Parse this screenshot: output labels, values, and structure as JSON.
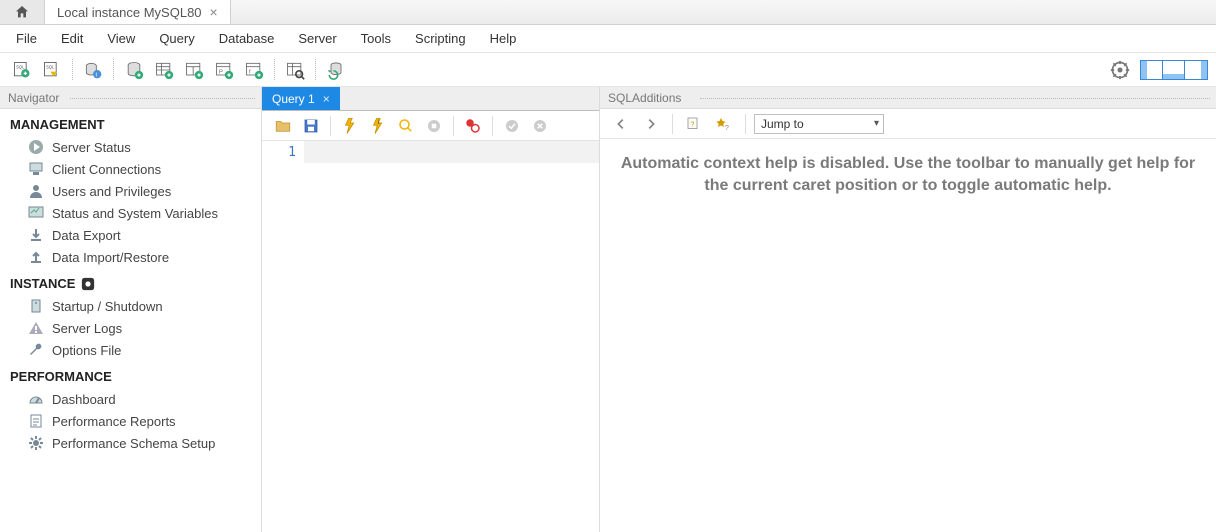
{
  "tabs": {
    "connection_label": "Local instance MySQL80"
  },
  "menu": {
    "file": "File",
    "edit": "Edit",
    "view": "View",
    "query": "Query",
    "database": "Database",
    "server": "Server",
    "tools": "Tools",
    "scripting": "Scripting",
    "help": "Help"
  },
  "navigator": {
    "title": "Navigator",
    "sections": {
      "management": {
        "heading": "MANAGEMENT",
        "items": [
          "Server Status",
          "Client Connections",
          "Users and Privileges",
          "Status and System Variables",
          "Data Export",
          "Data Import/Restore"
        ]
      },
      "instance": {
        "heading": "INSTANCE",
        "items": [
          "Startup / Shutdown",
          "Server Logs",
          "Options File"
        ]
      },
      "performance": {
        "heading": "PERFORMANCE",
        "items": [
          "Dashboard",
          "Performance Reports",
          "Performance Schema Setup"
        ]
      }
    }
  },
  "query": {
    "tab_label": "Query 1",
    "line_number": "1"
  },
  "sqladditions": {
    "title": "SQLAdditions",
    "jump_label": "Jump to",
    "help_text": "Automatic context help is disabled. Use the toolbar to manually get help for the current caret position or to toggle automatic help."
  }
}
